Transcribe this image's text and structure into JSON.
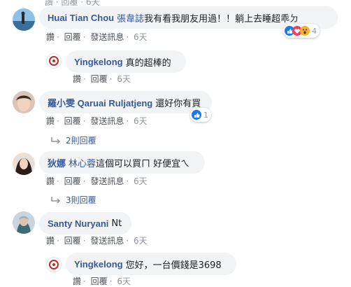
{
  "colors": {
    "link": "#385898",
    "bubble": "#f2f3f5",
    "meta": "#90949c",
    "like": "#1877f2",
    "love": "#f33e58",
    "wow": "#f7b125"
  },
  "top_partial": {
    "text": "讚 · 回覆 · 6天"
  },
  "comments": [
    {
      "author": "Huai Tian Chou",
      "tag": "張韋誌",
      "text": "我有看我朋友用過！！躺上去睡超乖ㄉ",
      "actions": {
        "like": "讚",
        "reply": "回覆",
        "translate": "發送訊息",
        "time": "6天"
      },
      "reactions": {
        "icons": [
          "like-icon",
          "love-icon",
          "wow-icon"
        ],
        "count": "4"
      },
      "replies": [
        {
          "author": "Yingkelong",
          "text": "真的超棒的",
          "actions": {
            "like": "讚",
            "reply": "回覆",
            "time": "6天"
          }
        }
      ]
    },
    {
      "author": "羅小雯 Qaruai Ruljatjeng",
      "text": "還好你有買",
      "actions": {
        "like": "讚",
        "reply": "回覆",
        "translate": "發送訊息",
        "time": "6天"
      },
      "reactions": {
        "icons": [
          "like-icon"
        ],
        "count": "1"
      },
      "more_replies": "2則回覆"
    },
    {
      "author": "狄娜",
      "tag": "林心蓉",
      "text": "這個可以買ㄇ 好便宜ㄟ",
      "actions": {
        "like": "讚",
        "reply": "回覆",
        "translate": "發送訊息",
        "time": "6天"
      },
      "more_replies": "3則回覆"
    },
    {
      "author": "Santy Nuryani",
      "text": "Nt",
      "actions": {
        "like": "讚",
        "reply": "回覆",
        "translate": "發送訊息",
        "time": "6天"
      },
      "replies": [
        {
          "author": "Yingkelong",
          "text": "您好，一台價錢是3698",
          "actions": {
            "like": "讚",
            "reply": "回覆",
            "time": "6天"
          }
        }
      ]
    }
  ]
}
